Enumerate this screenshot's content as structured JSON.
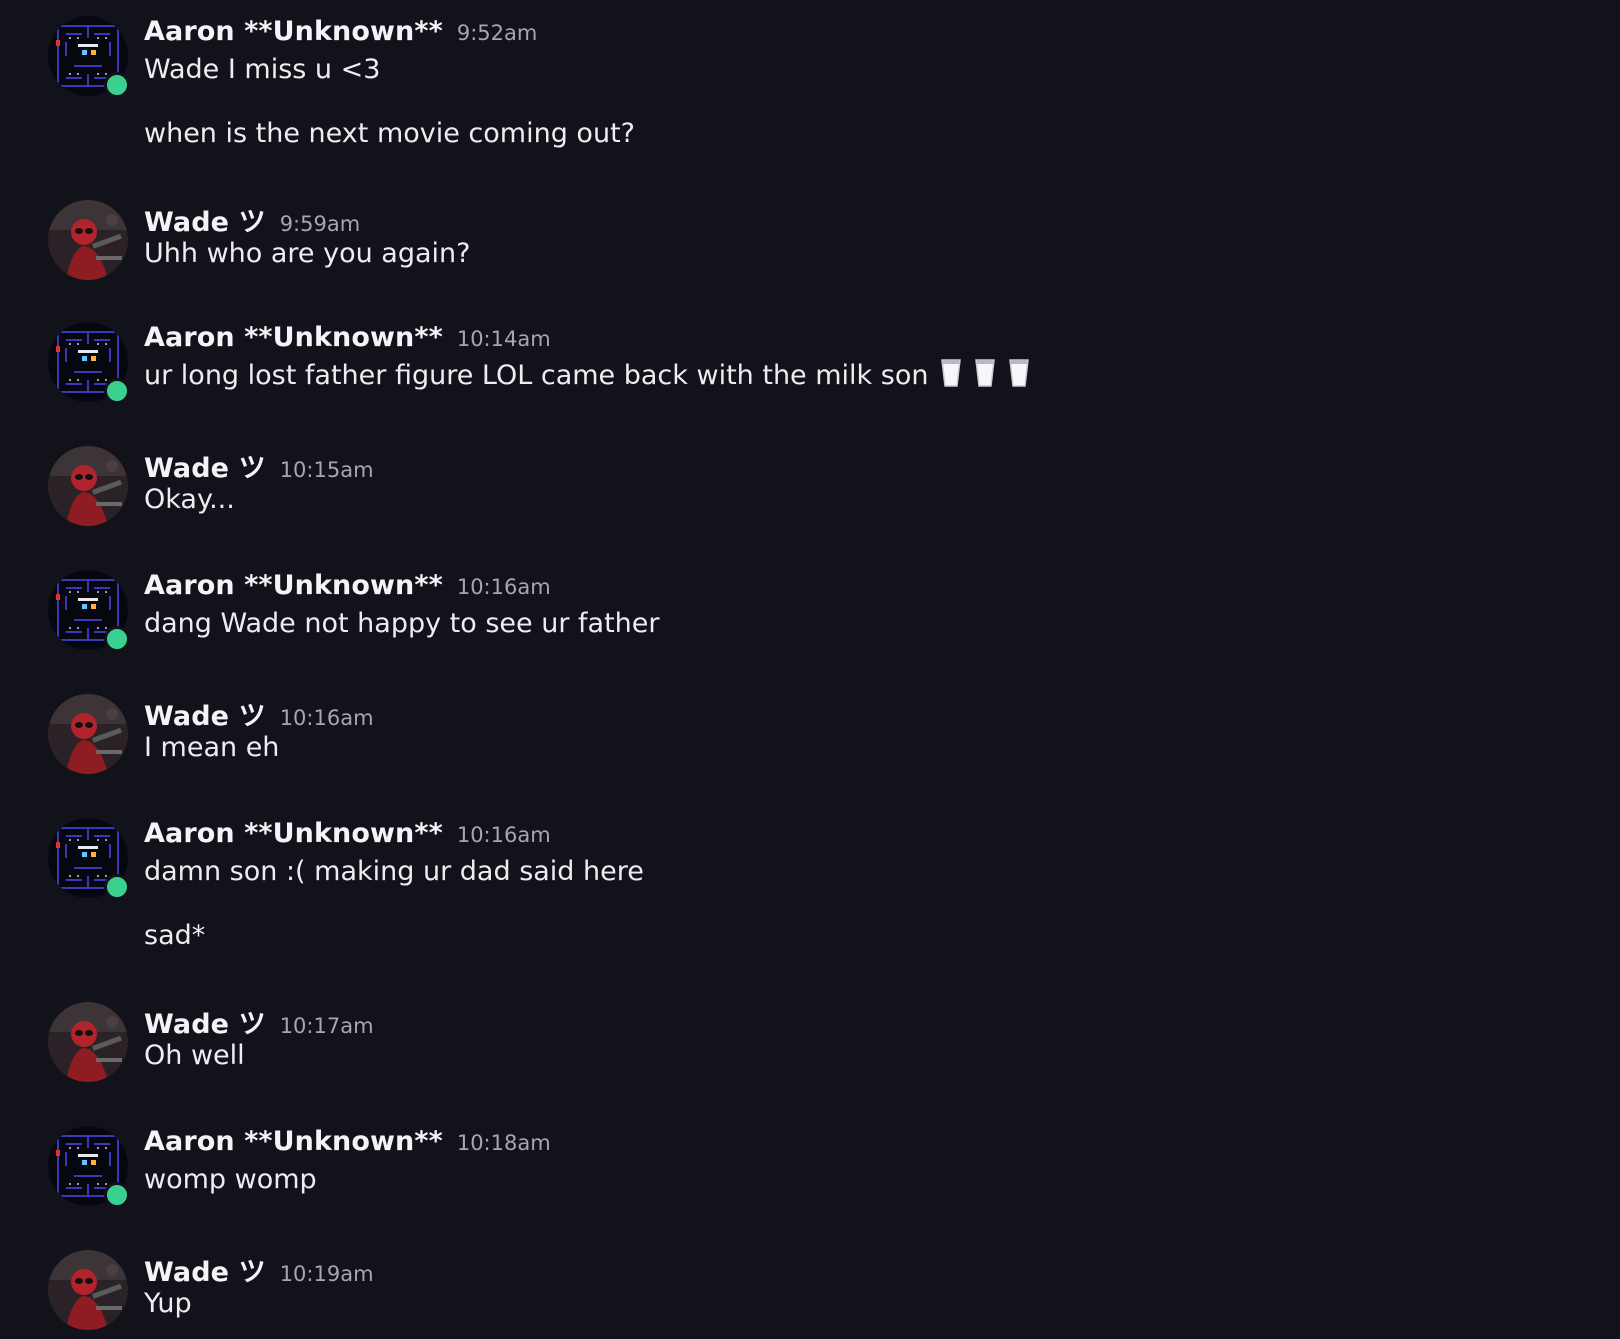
{
  "colors": {
    "background": "#12121a",
    "text": "#ececf1",
    "timestamp": "#a6a6b2",
    "online_status": "#3ad08f"
  },
  "icons": {
    "aaron_avatar": "pacman-maze-avatar",
    "wade_avatar": "deadpool-avatar",
    "milk_emoji": "glass-of-milk"
  },
  "messages": [
    {
      "author": "Aaron **Unknown**",
      "time": "9:52am",
      "avatar": "aaron",
      "online": true,
      "lines": [
        "Wade I miss u <3",
        "when is the next movie coming out?"
      ]
    },
    {
      "author": "Wade ツ",
      "time": "9:59am",
      "avatar": "wade",
      "online": false,
      "lines": [
        "Uhh who are you again?"
      ]
    },
    {
      "author": "Aaron **Unknown**",
      "time": "10:14am",
      "avatar": "aaron",
      "online": true,
      "lines": [
        "ur long lost father figure LOL came back with the milk son"
      ],
      "emoji_count": 3
    },
    {
      "author": "Wade ツ",
      "time": "10:15am",
      "avatar": "wade",
      "online": false,
      "lines": [
        "Okay..."
      ]
    },
    {
      "author": "Aaron **Unknown**",
      "time": "10:16am",
      "avatar": "aaron",
      "online": true,
      "lines": [
        "dang Wade not happy to see ur father"
      ]
    },
    {
      "author": "Wade ツ",
      "time": "10:16am",
      "avatar": "wade",
      "online": false,
      "lines": [
        "I mean eh"
      ]
    },
    {
      "author": "Aaron **Unknown**",
      "time": "10:16am",
      "avatar": "aaron",
      "online": true,
      "lines": [
        "damn son :( making ur dad said here",
        "sad*"
      ]
    },
    {
      "author": "Wade ツ",
      "time": "10:17am",
      "avatar": "wade",
      "online": false,
      "lines": [
        "Oh well"
      ]
    },
    {
      "author": "Aaron **Unknown**",
      "time": "10:18am",
      "avatar": "aaron",
      "online": true,
      "lines": [
        "womp womp"
      ]
    },
    {
      "author": "Wade ツ",
      "time": "10:19am",
      "avatar": "wade",
      "online": false,
      "lines": [
        "Yup"
      ]
    }
  ]
}
